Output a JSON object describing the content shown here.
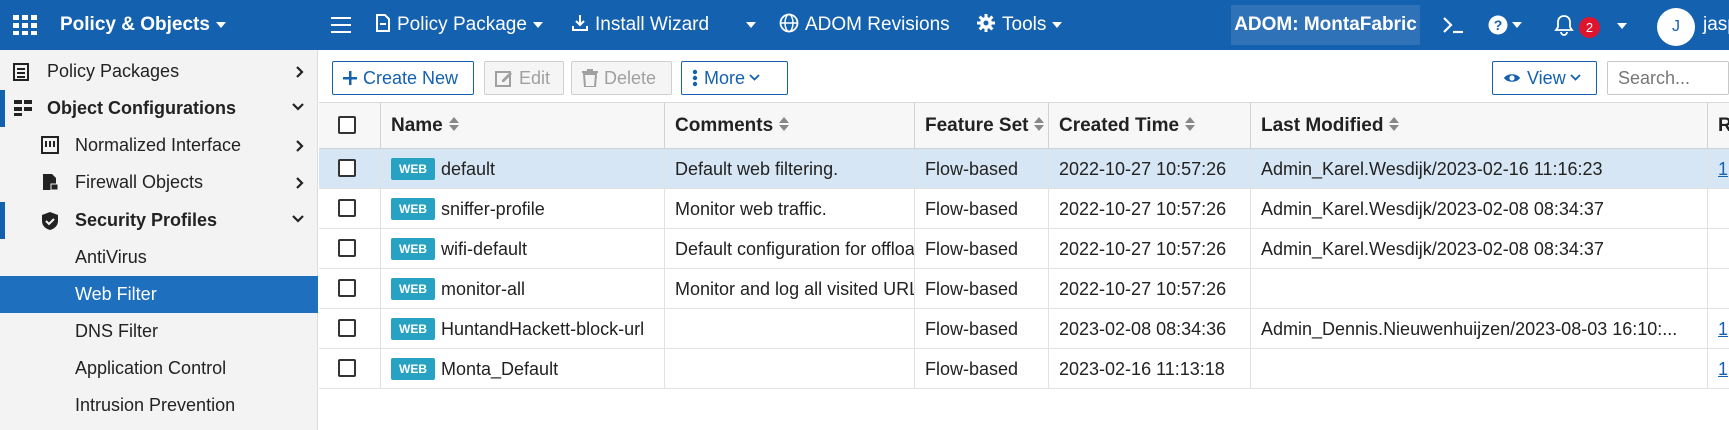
{
  "topbar": {
    "brand": "Policy & Objects",
    "nav": [
      {
        "label": "Policy Package",
        "icon": "document-icon"
      },
      {
        "label": "Install Wizard",
        "icon": "install-icon"
      },
      {
        "label": "ADOM Revisions",
        "icon": "globe-icon"
      },
      {
        "label": "Tools",
        "icon": "gear-icon"
      }
    ],
    "adom": "ADOM: MontaFabric",
    "notification_count": "2",
    "avatar_initial": "J",
    "username": "jasp"
  },
  "sidebar": {
    "items": [
      {
        "label": "Policy Packages",
        "icon": "clipboard-icon"
      },
      {
        "label": "Object Configurations",
        "icon": "objects-icon"
      },
      {
        "label": "Normalized Interface",
        "icon": "interface-icon"
      },
      {
        "label": "Firewall Objects",
        "icon": "firewall-icon"
      },
      {
        "label": "Security Profiles",
        "icon": "shield-icon"
      },
      {
        "label": "AntiVirus"
      },
      {
        "label": "Web Filter"
      },
      {
        "label": "DNS Filter"
      },
      {
        "label": "Application Control"
      },
      {
        "label": "Intrusion Prevention"
      }
    ]
  },
  "toolbar": {
    "create_new": "Create New",
    "edit": "Edit",
    "delete": "Delete",
    "more": "More",
    "view": "View",
    "search_placeholder": "Search..."
  },
  "table": {
    "columns": [
      "Name",
      "Comments",
      "Feature Set",
      "Created Time",
      "Last Modified",
      "R"
    ],
    "type_badge": "WEB",
    "rows": [
      {
        "name": "default",
        "comments": "Default web filtering.",
        "feature_set": "Flow-based",
        "created": "2022-10-27 10:57:26",
        "modified": "Admin_Karel.Wesdijk/2023-02-16 11:16:23",
        "ref": "1"
      },
      {
        "name": "sniffer-profile",
        "comments": "Monitor web traffic.",
        "feature_set": "Flow-based",
        "created": "2022-10-27 10:57:26",
        "modified": "Admin_Karel.Wesdijk/2023-02-08 08:34:37",
        "ref": ""
      },
      {
        "name": "wifi-default",
        "comments": "Default configuration for offloading",
        "feature_set": "Flow-based",
        "created": "2022-10-27 10:57:26",
        "modified": "Admin_Karel.Wesdijk/2023-02-08 08:34:37",
        "ref": ""
      },
      {
        "name": "monitor-all",
        "comments": "Monitor and log all visited URLs",
        "feature_set": "Flow-based",
        "created": "2022-10-27 10:57:26",
        "modified": "",
        "ref": ""
      },
      {
        "name": "HuntandHackett-block-url",
        "comments": "",
        "feature_set": "Flow-based",
        "created": "2023-02-08 08:34:36",
        "modified": "Admin_Dennis.Nieuwenhuijzen/2023-08-03 16:10:...",
        "ref": "1"
      },
      {
        "name": "Monta_Default",
        "comments": "",
        "feature_set": "Flow-based",
        "created": "2023-02-16 11:13:18",
        "modified": "",
        "ref": "1"
      }
    ],
    "selected_row": 0
  },
  "colors": {
    "topbar": "#1461b0",
    "selected_nav": "#1f6fbf",
    "selected_row": "#d7e6f4",
    "web_badge": "#27a2c2",
    "notification": "#e0142c"
  }
}
